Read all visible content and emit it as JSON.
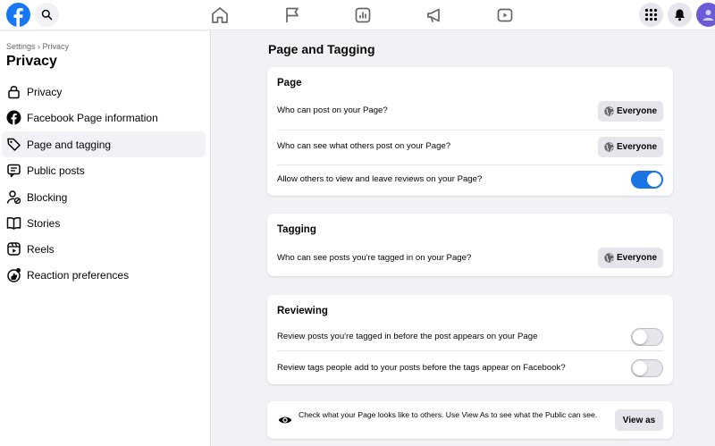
{
  "colors": {
    "brand": "#1877f2",
    "toggle_on": "#1b74e4",
    "page_bg": "#f0f2f5",
    "button_bg": "#e4e6eb"
  },
  "topbar": {
    "left_icons": [
      "facebook-logo",
      "search-icon"
    ],
    "nav_icons": [
      "home-icon",
      "flag-icon",
      "ads-manager-icon",
      "megaphone-icon",
      "video-icon"
    ],
    "right_icons": [
      "menu-grid-icon",
      "bell-icon",
      "avatar"
    ]
  },
  "sidebar": {
    "breadcrumb": "Settings › Privacy",
    "title": "Privacy",
    "items": [
      {
        "label": "Privacy",
        "icon": "lock-icon"
      },
      {
        "label": "Facebook Page information",
        "icon": "facebook-circle-icon"
      },
      {
        "label": "Page and tagging",
        "icon": "tag-icon",
        "active": true
      },
      {
        "label": "Public posts",
        "icon": "public-posts-icon"
      },
      {
        "label": "Blocking",
        "icon": "block-user-icon"
      },
      {
        "label": "Stories",
        "icon": "book-icon"
      },
      {
        "label": "Reels",
        "icon": "reels-icon"
      },
      {
        "label": "Reaction preferences",
        "icon": "reaction-icon"
      }
    ]
  },
  "main": {
    "title": "Page and Tagging",
    "page_section": {
      "title": "Page",
      "rows": [
        {
          "label": "Who can post on your Page?",
          "value": "Everyone"
        },
        {
          "label": "Who can see what others post on your Page?",
          "value": "Everyone"
        },
        {
          "label": "Allow others to view and leave reviews on your Page?",
          "toggle_on": true
        }
      ]
    },
    "tagging_section": {
      "title": "Tagging",
      "rows": [
        {
          "label": "Who can see posts you're tagged in on your Page?",
          "value": "Everyone"
        }
      ]
    },
    "reviewing_section": {
      "title": "Reviewing",
      "rows": [
        {
          "label": "Review posts you're tagged in before the post appears on your Page",
          "toggle_on": false
        },
        {
          "label": "Review tags people add to your posts before the tags appear on Facebook?",
          "toggle_on": false
        }
      ]
    },
    "view_as": {
      "text": "Check what your Page looks like to others. Use View As to see what the Public can see.",
      "button": "View as"
    }
  }
}
